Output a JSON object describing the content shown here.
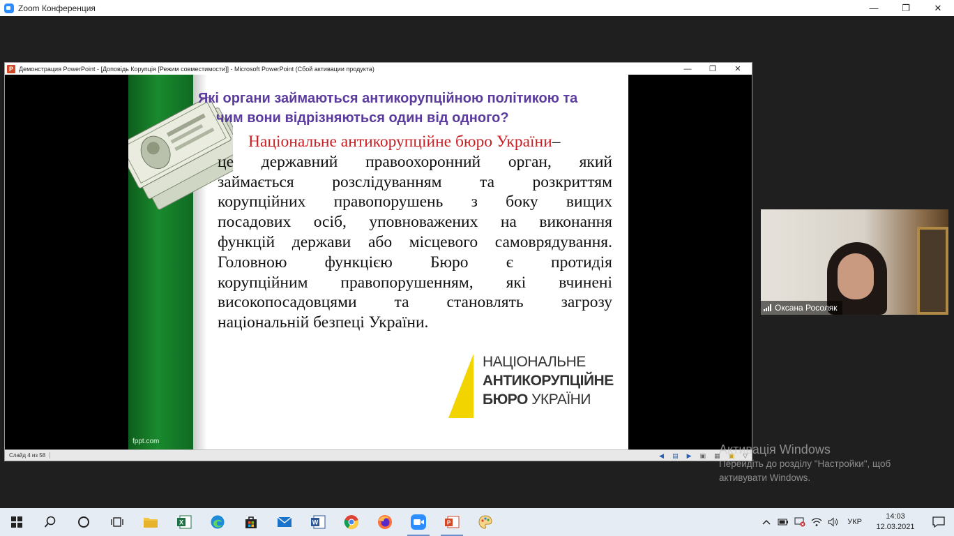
{
  "zoom": {
    "title": "Zoom Конференция",
    "minimize": "—",
    "restore": "❐",
    "close": "✕"
  },
  "ppt": {
    "title": "Демонстрация PowerPoint - [Доповідь Корупція [Режим совместимости]] - Microsoft PowerPoint (Сбой активации продукта)",
    "icon_letter": "P",
    "minimize": "—",
    "restore": "❐",
    "close": "✕",
    "status_slide": "Слайд 4 из 58"
  },
  "slide": {
    "question_line1": "Які  органи займаються антикорупційною політикою та",
    "question_line2": "чим вони відрізняються один від одного?",
    "body_red": "Національне антикорупційне бюро України",
    "body_dash": " –",
    "body_lines": [
      [
        "це",
        "державний",
        "правоохоронний",
        "орган,",
        "який"
      ],
      [
        "займається",
        "розслідуванням",
        "та",
        "розкриттям"
      ],
      [
        "корупційних",
        "правопорушень",
        "з",
        "боку",
        "вищих"
      ],
      [
        "посадових",
        "осіб,",
        "уповноважених",
        "на",
        "виконання"
      ],
      [
        "функцій",
        "держави",
        "або",
        "місцевого",
        "самоврядування."
      ],
      [
        "Головною",
        "функцією",
        "Бюро",
        "є",
        "протидія"
      ],
      [
        "корупційним",
        "правопорушенням,",
        "які",
        "вчинені"
      ],
      [
        "високопосадовцями",
        "та",
        "становлять",
        "загрозу"
      ]
    ],
    "body_last": "національній безпеці України.",
    "logo_line1": "НАЦІОНАЛЬНЕ",
    "logo_line2": "АНТИКОРУПЦІЙНЕ",
    "logo_line3_bold": "БЮРО",
    "logo_line3_rest": " УКРАЇНИ",
    "watermark": "fppt.com"
  },
  "video": {
    "participant": "Оксана Росоляк"
  },
  "activation": {
    "title": "Активація Windows",
    "line1": "Перейдіть до розділу \"Настройки\", щоб",
    "line2": "активувати Windows."
  },
  "taskbar": {
    "lang": "УКР",
    "time": "14:03",
    "date": "12.03.2021"
  },
  "colors": {
    "question": "#5b3c9e",
    "nabu_red": "#c81f24",
    "logo_yellow": "#f2d500",
    "slide_green": "#1a8a2e"
  }
}
